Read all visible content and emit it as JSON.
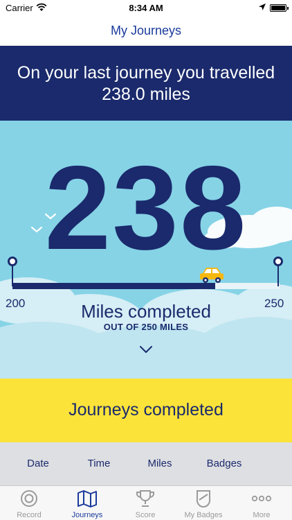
{
  "status_bar": {
    "carrier": "Carrier",
    "time": "8:34 AM"
  },
  "nav": {
    "title": "My Journeys"
  },
  "banner": {
    "text": "On your last journey you travelled 238.0 miles"
  },
  "progress": {
    "value": "238",
    "min_label": "200",
    "max_label": "250",
    "completed_fraction": 0.76,
    "miles_label": "Miles completed",
    "out_of_label": "OUT OF 250 MILES"
  },
  "journeys": {
    "label": "Journeys completed"
  },
  "table": {
    "columns": [
      "Date",
      "Time",
      "Miles",
      "Badges"
    ]
  },
  "tabs": [
    {
      "label": "Record",
      "icon": "record-icon",
      "active": false
    },
    {
      "label": "Journeys",
      "icon": "map-icon",
      "active": true
    },
    {
      "label": "Score",
      "icon": "trophy-icon",
      "active": false
    },
    {
      "label": "My Badges",
      "icon": "badge-shield-icon",
      "active": false
    },
    {
      "label": "More",
      "icon": "more-dots-icon",
      "active": false
    }
  ],
  "colors": {
    "navy": "#1a2a6c",
    "sky": "#86d3e6",
    "yellow": "#fbe33a",
    "accent": "#1a3a9b"
  }
}
